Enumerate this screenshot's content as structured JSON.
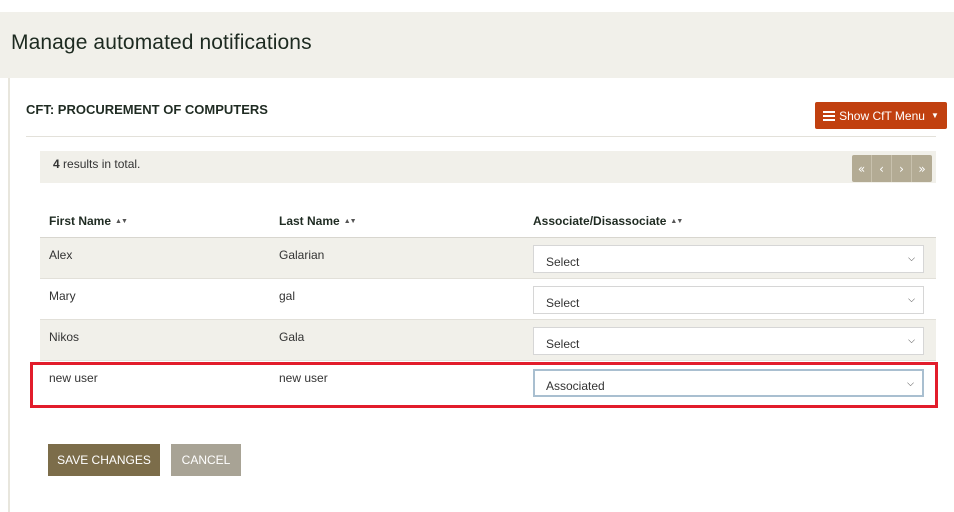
{
  "page": {
    "title": "Manage automated notifications"
  },
  "cft": {
    "title": "CFT: PROCUREMENT OF COMPUTERS",
    "menu_button_label": "Show CfT Menu"
  },
  "results": {
    "count": "4",
    "suffix": " results in total."
  },
  "pager": {
    "first": "«",
    "prev": "‹",
    "next": "›",
    "last": "»"
  },
  "table": {
    "headers": {
      "first_name": "First Name",
      "last_name": "Last Name",
      "associate": "Associate/Disassociate"
    },
    "rows": [
      {
        "first_name": "Alex",
        "last_name": "Galarian",
        "select_value": "Select"
      },
      {
        "first_name": "Mary",
        "last_name": "gal",
        "select_value": "Select"
      },
      {
        "first_name": "Nikos",
        "last_name": "Gala",
        "select_value": "Select"
      },
      {
        "first_name": "new user",
        "last_name": "new user",
        "select_value": "Associated"
      }
    ]
  },
  "actions": {
    "save_label": "SAVE CHANGES",
    "cancel_label": "CANCEL"
  },
  "colors": {
    "accent": "#c1400f",
    "save_button": "#7c6d4a",
    "cancel_button": "#a8a395",
    "highlight": "#e21c2b",
    "header_bg": "#f1f0ea"
  },
  "icons": {
    "menu": "list-icon",
    "sort": "sort-icon",
    "dropdown": "chevron-down-icon"
  }
}
